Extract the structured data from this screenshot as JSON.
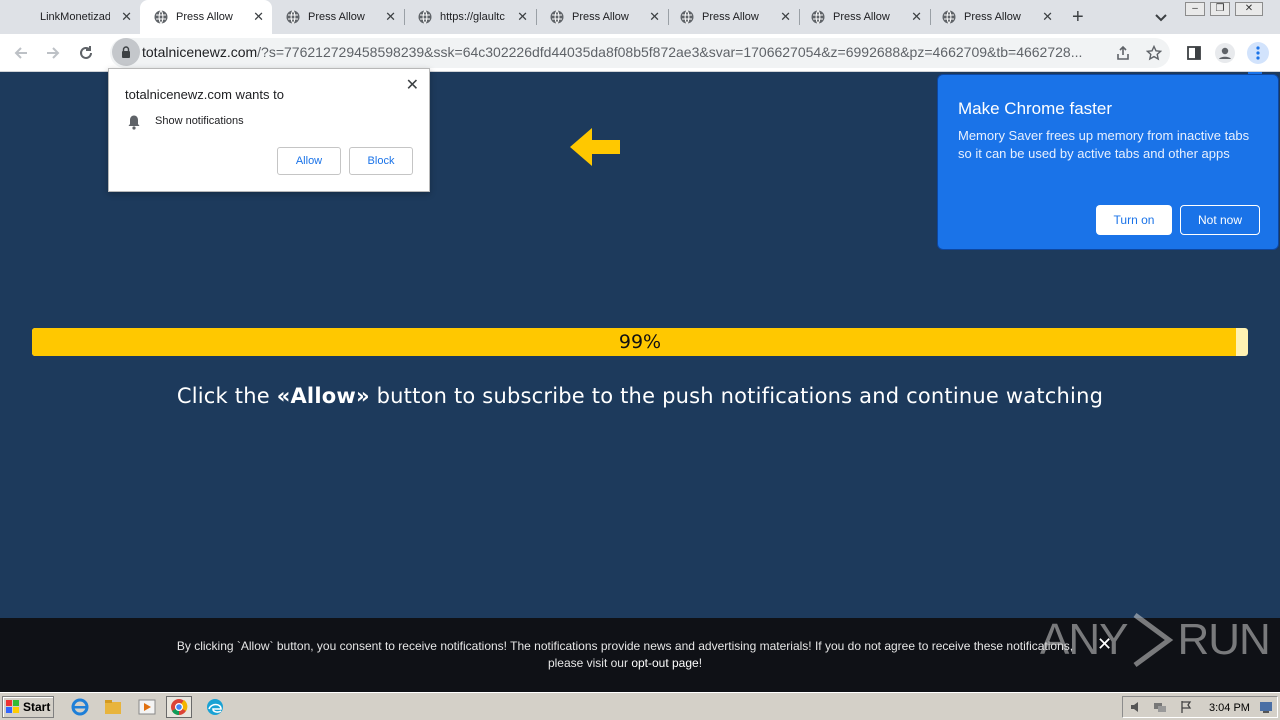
{
  "tabs": [
    {
      "label": "LinkMonetizad",
      "close": "✕",
      "icon": "none"
    },
    {
      "label": "Press Allow",
      "close": "✕",
      "icon": "globe-icon",
      "active": true
    },
    {
      "label": "Press Allow",
      "close": "✕",
      "icon": "globe-icon"
    },
    {
      "label": "https://glaultc",
      "close": "✕",
      "icon": "globe-icon"
    },
    {
      "label": "Press Allow",
      "close": "✕",
      "icon": "globe-icon"
    },
    {
      "label": "Press Allow",
      "close": "✕",
      "icon": "globe-icon"
    },
    {
      "label": "Press Allow",
      "close": "✕",
      "icon": "globe-icon"
    },
    {
      "label": "Press Allow",
      "close": "✕",
      "icon": "globe-icon"
    }
  ],
  "newtab": "+",
  "address": {
    "host": "totalnicenewz.com",
    "path": "/?s=776212729458598239&ssk=64c302226dfd44035da8f08b5f872ae3&svar=1706627054&z=6992688&pz=4662709&tb=4662728..."
  },
  "permission": {
    "title": "totalnicenewz.com wants to",
    "item": "Show notifications",
    "allow": "Allow",
    "block": "Block",
    "close": "✕"
  },
  "bubble": {
    "title": "Make Chrome faster",
    "body": "Memory Saver frees up memory from inactive tabs so it can be used by active tabs and other apps",
    "turn_on": "Turn on",
    "not_now": "Not now"
  },
  "progress": {
    "value": 0.99,
    "label": "99%"
  },
  "headline": {
    "before": "Click the ",
    "strong": "«Allow»",
    "after": " button to subscribe to the push notifications and continue watching"
  },
  "footer": {
    "line1": "By clicking `Allow` button, you consent to receive notifications! The notifications provide news and advertising materials! If you do not agree to receive these notifications,",
    "line2_prefix": "please visit our ",
    "optout": "opt-out page",
    "line2_suffix": "!",
    "close": "✕"
  },
  "watermark": {
    "left": "ANY",
    "right": "RUN"
  },
  "taskbar": {
    "start": "Start",
    "clock": "3:04 PM"
  },
  "colors": {
    "accent": "#ffc800",
    "page_bg": "#1d3a5c",
    "bubble": "#1a73e8"
  }
}
